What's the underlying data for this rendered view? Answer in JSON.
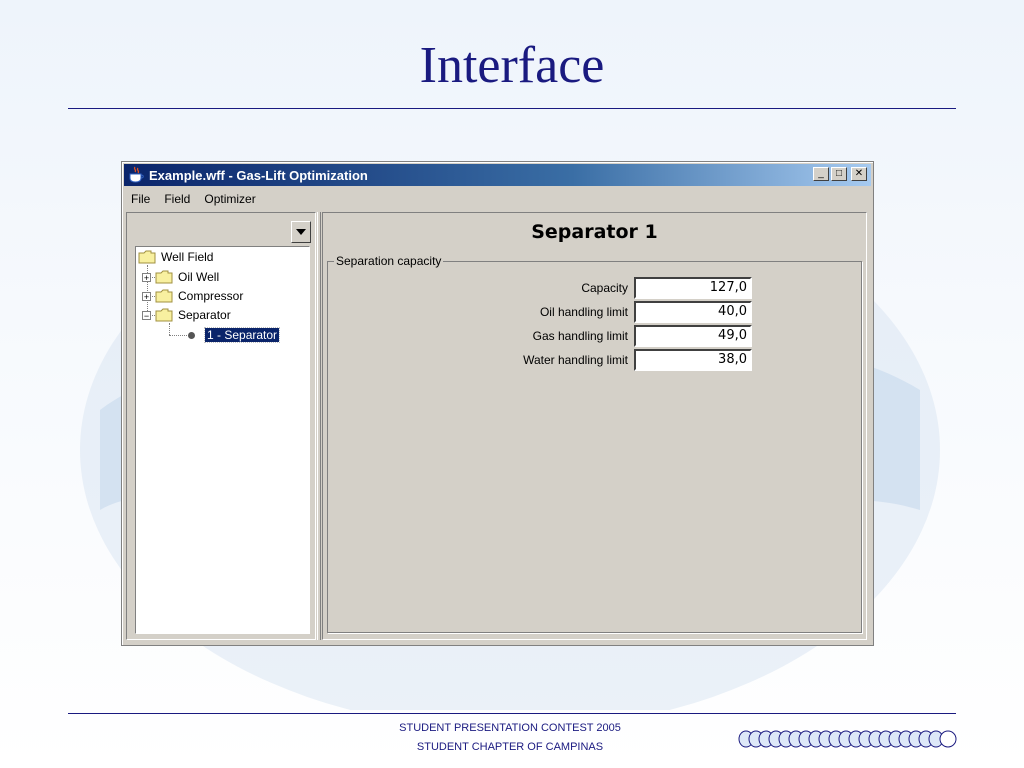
{
  "slide": {
    "title": "Interface",
    "footer_line1": "STUDENT PRESENTATION CONTEST 2005",
    "footer_line2": "STUDENT CHAPTER OF CAMPINAS"
  },
  "window": {
    "title": "Example.wff - Gas-Lift Optimization",
    "minimize_label": "_",
    "maximize_label": "□",
    "close_label": "✕"
  },
  "menubar": {
    "items": [
      {
        "label": "File"
      },
      {
        "label": "Field"
      },
      {
        "label": "Optimizer"
      }
    ]
  },
  "tree": {
    "root": "Well Field",
    "nodes": [
      {
        "label": "Oil Well",
        "expander": "+"
      },
      {
        "label": "Compressor",
        "expander": "+"
      },
      {
        "label": "Separator",
        "expander": "−"
      }
    ],
    "selected_leaf": "1 - Separator"
  },
  "panel": {
    "title": "Separator 1",
    "group_title": "Separation capacity",
    "fields": [
      {
        "label": "Capacity",
        "value": "127,0"
      },
      {
        "label": "Oil handling limit",
        "value": "40,0"
      },
      {
        "label": "Gas handling limit",
        "value": "49,0"
      },
      {
        "label": "Water handling limit",
        "value": "38,0"
      }
    ]
  },
  "colors": {
    "slide_accent": "#1a1a80",
    "titlebar": "#0a246a",
    "selection": "#0a246a"
  },
  "icons": {
    "app": "java-cup-icon",
    "folder": "folder-icon",
    "dropdown": "triangle-down-icon"
  }
}
